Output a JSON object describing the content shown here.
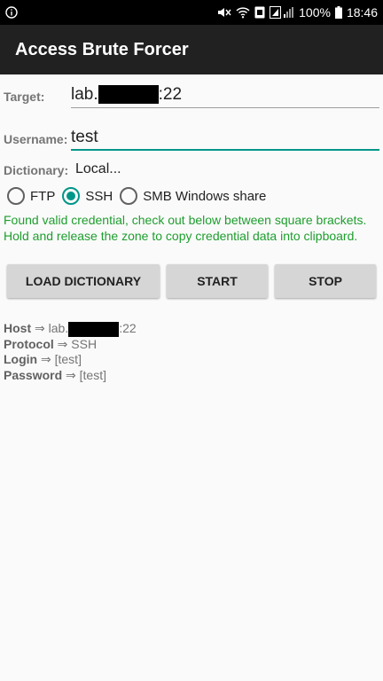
{
  "status_bar": {
    "battery": "100%",
    "time": "18:46",
    "icons": [
      "info-icon",
      "mute-icon",
      "wifi-icon",
      "data-icon",
      "signal-icon",
      "battery-icon"
    ]
  },
  "app": {
    "title": "Access Brute Forcer"
  },
  "form": {
    "target_label": "Target:",
    "target_prefix": "lab.",
    "target_suffix": ":22",
    "username_label": "Username:",
    "username_value": "test",
    "dictionary_label": "Dictionary:",
    "dictionary_value": "Local..."
  },
  "protocols": {
    "options": [
      "FTP",
      "SSH",
      "SMB Windows share"
    ],
    "selected": "SSH"
  },
  "message": "Found valid credential, check out below between square brackets. Hold and release the zone to copy credential data into clipboard.",
  "buttons": {
    "load": "LOAD DICTIONARY",
    "start": "START",
    "stop": "STOP"
  },
  "result": {
    "host_label": "Host",
    "host_prefix": " ⇒ lab.",
    "host_suffix": ":22",
    "protocol_label": "Protocol",
    "protocol_value": " ⇒ SSH",
    "login_label": "Login",
    "login_value": " ⇒ [test]",
    "password_label": "Password",
    "password_value": " ⇒ [test]"
  },
  "colors": {
    "accent": "#009688",
    "success_text": "#1e9e2e",
    "app_bar": "#212121",
    "button_bg": "#d6d6d6"
  }
}
